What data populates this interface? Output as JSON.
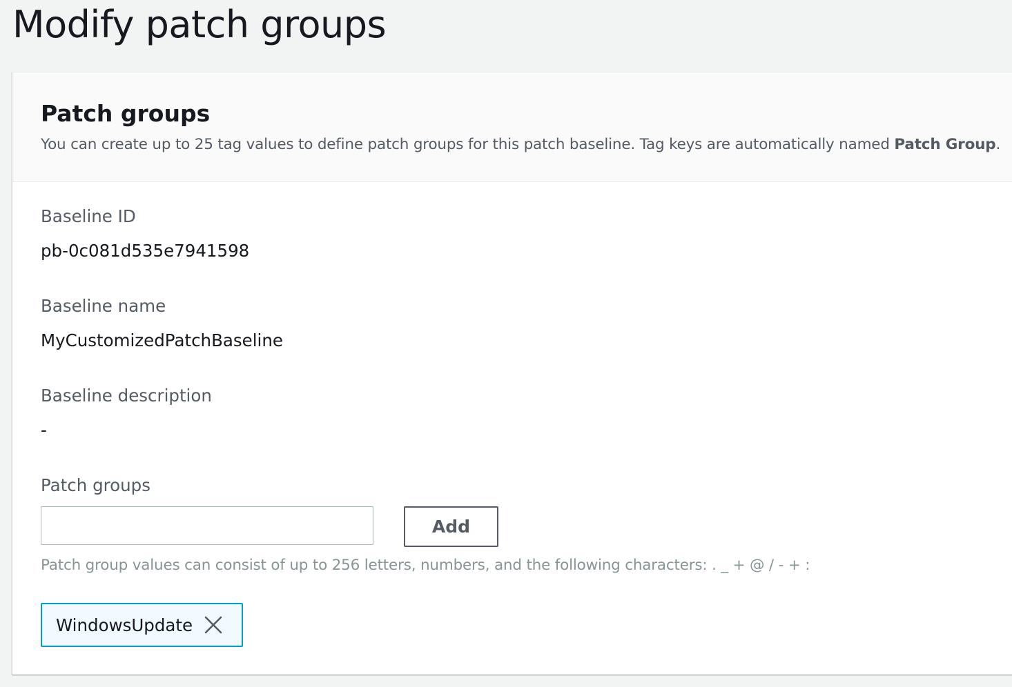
{
  "page": {
    "title": "Modify patch groups"
  },
  "container": {
    "title": "Patch groups",
    "description_prefix": "You can create up to 25 tag values to define patch groups for this patch baseline. Tag keys are automatically named ",
    "description_bold": "Patch Group",
    "description_suffix": "."
  },
  "fields": {
    "baseline_id_label": "Baseline ID",
    "baseline_id_value": "pb-0c081d535e7941598",
    "baseline_name_label": "Baseline name",
    "baseline_name_value": "MyCustomizedPatchBaseline",
    "baseline_description_label": "Baseline description",
    "baseline_description_value": "-"
  },
  "patch_groups": {
    "label": "Patch groups",
    "input_value": "",
    "add_label": "Add",
    "hint": "Patch group values can consist of up to 256 letters, numbers, and the following characters: . _ + @ / - + :",
    "tokens": [
      {
        "label": "WindowsUpdate",
        "dismiss_icon": "close-icon"
      }
    ]
  },
  "colors": {
    "highlight": "#e8502b",
    "token_border": "#00a1c9",
    "token_background": "#f1faff"
  }
}
